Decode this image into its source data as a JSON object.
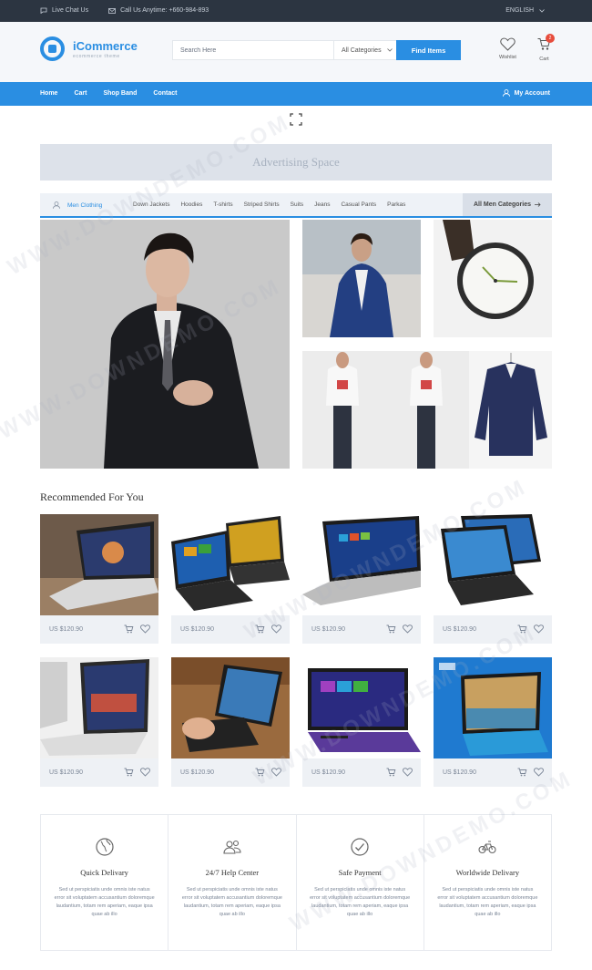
{
  "topbar": {
    "live_chat": "Live Chat Us",
    "call_us": "Call Us Anytime: +660-984-893",
    "language": "ENGLISH"
  },
  "brand": {
    "name": "iCommerce",
    "tagline": "ecommerce theme"
  },
  "search": {
    "placeholder": "Search Here",
    "category": "All Categories",
    "button": "Find Items"
  },
  "header_actions": {
    "wishlist": "Wishlist",
    "cart": "Cart",
    "cart_count": "2"
  },
  "nav": {
    "items": [
      "Home",
      "Cart",
      "Shop Band",
      "Contact"
    ],
    "account": "My Account"
  },
  "ad": {
    "text": "Advertising Space"
  },
  "category_bar": {
    "active": "Men Clothing",
    "links": [
      "Down Jackets",
      "Hoodies",
      "T-shirts",
      "Striped Shirts",
      "Suits",
      "Jeans",
      "Casual Pants",
      "Parkas"
    ],
    "all": "All Men Categories"
  },
  "recommended": {
    "title": "Recommended For You",
    "products": [
      {
        "price": "US $120.90"
      },
      {
        "price": "US $120.90"
      },
      {
        "price": "US $120.90"
      },
      {
        "price": "US $120.90"
      },
      {
        "price": "US $120.90"
      },
      {
        "price": "US $120.90"
      },
      {
        "price": "US $120.90"
      },
      {
        "price": "US $120.90"
      }
    ]
  },
  "features": [
    {
      "title": "Quick Delivary",
      "icon": "globe-icon",
      "text": "Sed ut perspiciatis unde omnis iste natus error sit voluptatem accusantium doloremque laudantium, totam rem aperiam, eaque ipsa quae ab illo"
    },
    {
      "title": "24/7 Help Center",
      "icon": "users-icon",
      "text": "Sed ut perspiciatis unde omnis iste natus error sit voluptatem accusantium doloremque laudantium, totam rem aperiam, eaque ipsa quae ab illo"
    },
    {
      "title": "Safe Payment",
      "icon": "check-circle-icon",
      "text": "Sed ut perspiciatis unde omnis iste natus error sit voluptatem accusantium doloremque laudantium, totam rem aperiam, eaque ipsa quae ab illo"
    },
    {
      "title": "Worldwide Delivary",
      "icon": "bicycle-icon",
      "text": "Sed ut perspiciatis unde omnis iste natus error sit voluptatem accusantium doloremque laudantium, totam rem aperiam, eaque ipsa quae ab illo"
    }
  ],
  "watermark": "WWW.DOWNDEMO.COM",
  "colors": {
    "accent": "#2a8ee2",
    "topbar": "#2c3541",
    "badge": "#e74c3c"
  }
}
